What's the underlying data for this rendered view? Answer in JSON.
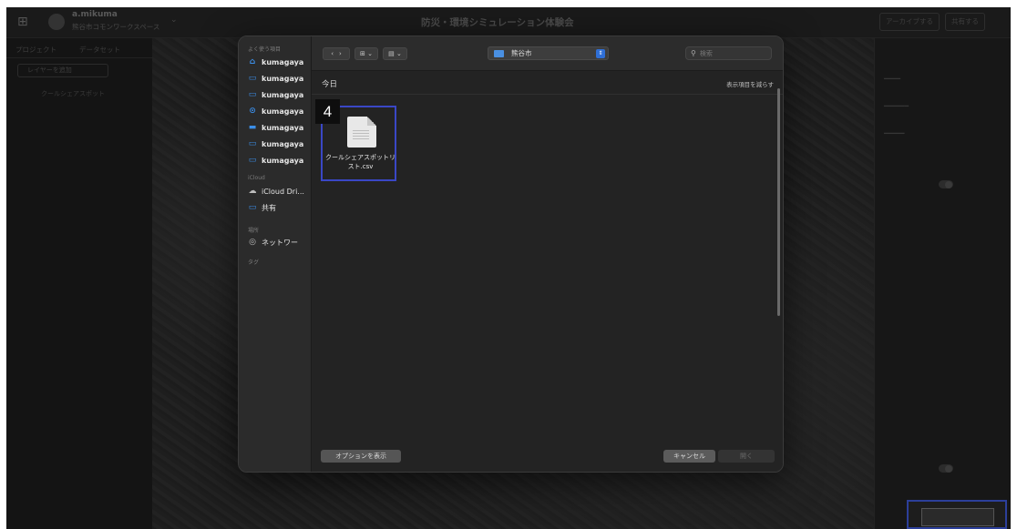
{
  "app": {
    "user": "a.mikuma",
    "workspace": "熊谷市コモンワークスペース",
    "title": "防災・環境シミュレーション体験会",
    "buttons": [
      "アーカイブする",
      "共有する"
    ],
    "left_tabs": [
      "プロジェクト",
      "データセット"
    ],
    "add_layer": "レイヤーを追加",
    "layer_item": "クールシェアスポット"
  },
  "dialog": {
    "sidebar": {
      "favorites_label": "よく使う項目",
      "favorites": [
        {
          "label": "kumagaya",
          "icon": "home-icon"
        },
        {
          "label": "kumagaya",
          "icon": "folder-icon"
        },
        {
          "label": "kumagaya",
          "icon": "folder-icon"
        },
        {
          "label": "kumagaya",
          "icon": "download-icon"
        },
        {
          "label": "kumagaya",
          "icon": "desktop-icon"
        },
        {
          "label": "kumagaya",
          "icon": "folder-icon"
        },
        {
          "label": "kumagaya",
          "icon": "folder-icon"
        }
      ],
      "icloud_label": "iCloud",
      "icloud": [
        {
          "label": "iCloud Dri...",
          "icon": "cloud-icon"
        },
        {
          "label": "共有",
          "icon": "shared-folder-icon"
        }
      ],
      "locations_label": "場所",
      "locations": [
        {
          "label": "ネットワー",
          "icon": "network-icon"
        }
      ],
      "tags_label": "タグ"
    },
    "toolbar": {
      "path": "熊谷市",
      "search_placeholder": "検索"
    },
    "section_title": "今日",
    "show_fewer": "表示項目を減らす",
    "file": {
      "name": "クールシェアスポットリスト.csv",
      "step_badge": "4"
    },
    "options_button": "オプションを表示",
    "cancel_button": "キャンセル",
    "open_button": "開く"
  },
  "colors": {
    "selection": "#3a47c6",
    "accent": "#3b8ee8"
  }
}
